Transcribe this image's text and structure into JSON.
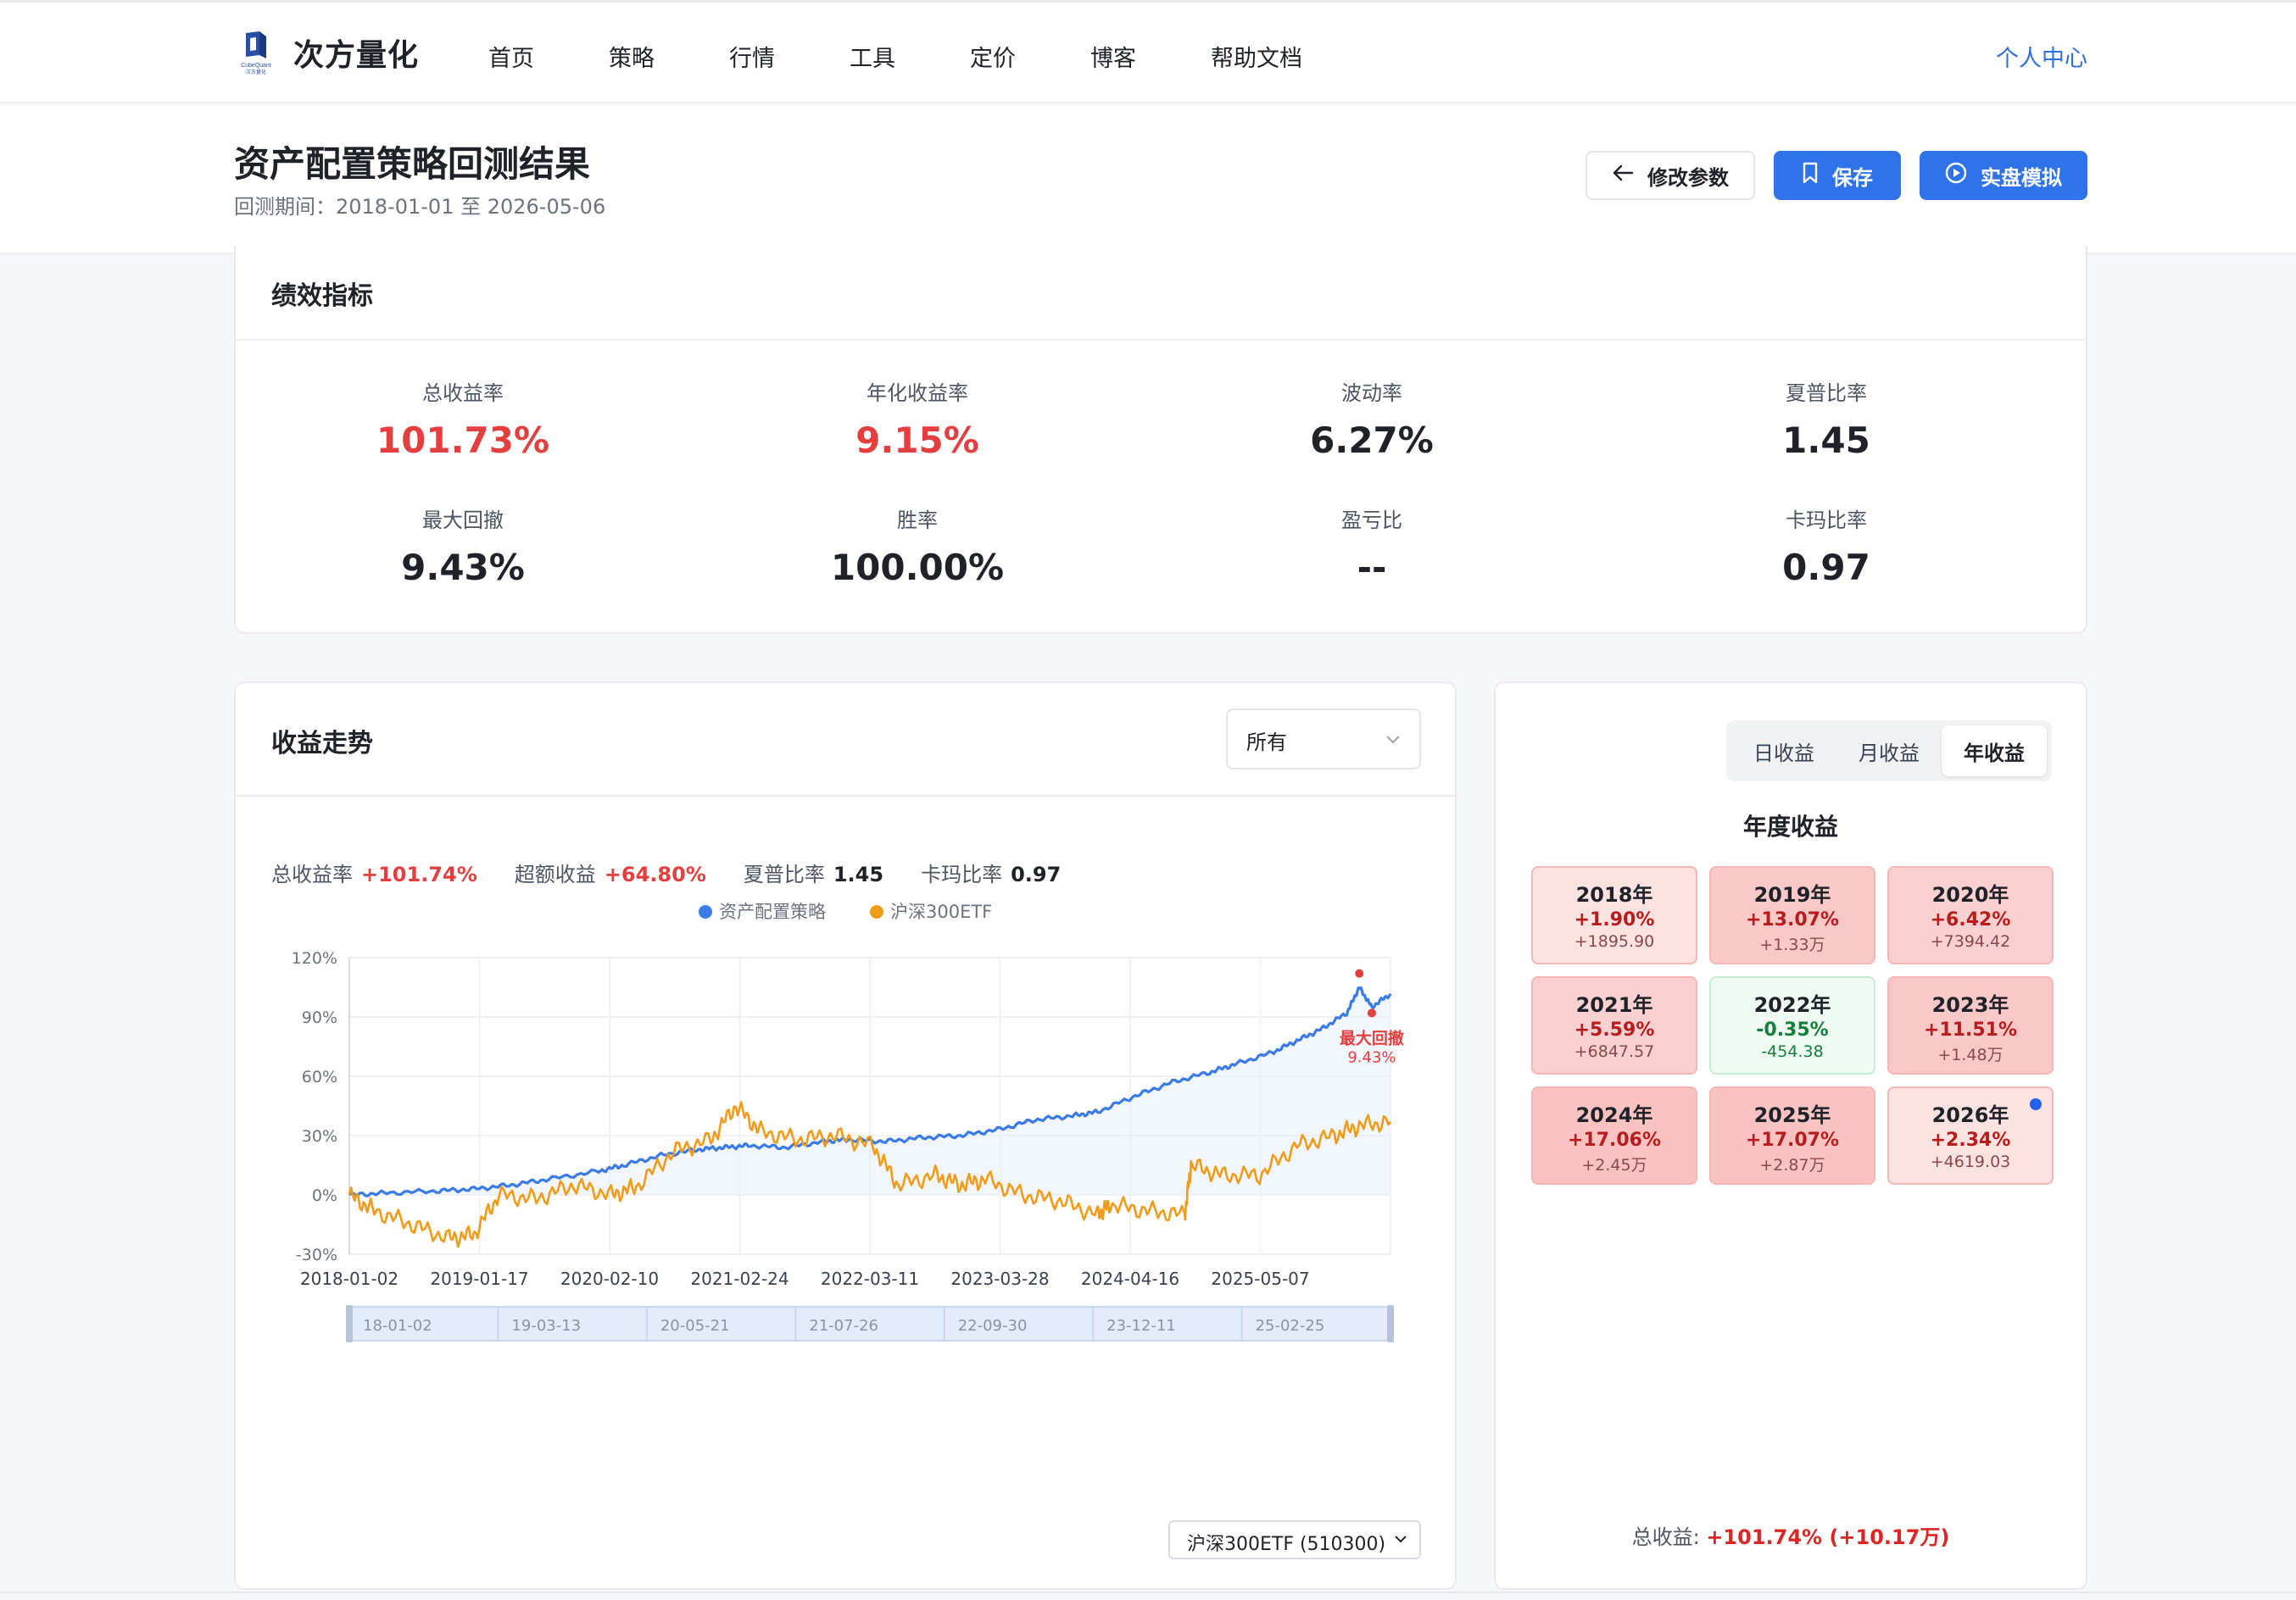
{
  "nav": {
    "brand": "次方量化",
    "logo_text": "CubeQuant 次方量化",
    "links": [
      "首页",
      "策略",
      "行情",
      "工具",
      "定价",
      "博客",
      "帮助文档"
    ],
    "user_center": "个人中心"
  },
  "header": {
    "title": "资产配置策略回测结果",
    "period": "回测期间：2018-01-01 至 2026-05-06",
    "btn_edit": "修改参数",
    "btn_save": "保存",
    "btn_sim": "实盘模拟"
  },
  "performance": {
    "title": "绩效指标",
    "metrics": [
      {
        "label": "总收益率",
        "value": "101.73%",
        "highlight": true
      },
      {
        "label": "年化收益率",
        "value": "9.15%",
        "highlight": true
      },
      {
        "label": "波动率",
        "value": "6.27%",
        "highlight": false
      },
      {
        "label": "夏普比率",
        "value": "1.45",
        "highlight": false
      },
      {
        "label": "最大回撤",
        "value": "9.43%",
        "highlight": false
      },
      {
        "label": "胜率",
        "value": "100.00%",
        "highlight": false
      },
      {
        "label": "盈亏比",
        "value": "--",
        "highlight": false
      },
      {
        "label": "卡玛比率",
        "value": "0.97",
        "highlight": false
      }
    ]
  },
  "trend": {
    "title": "收益走势",
    "range_select": "所有",
    "stats": [
      {
        "label": "总收益率",
        "value": "+101.74%",
        "color": "red"
      },
      {
        "label": "超额收益",
        "value": "+64.80%",
        "color": "red"
      },
      {
        "label": "夏普比率",
        "value": "1.45",
        "color": "dark"
      },
      {
        "label": "卡玛比率",
        "value": "0.97",
        "color": "dark"
      }
    ],
    "benchmark_select": "沪深300ETF (510300)"
  },
  "chart_data": {
    "type": "line",
    "legend": [
      "资产配置策略",
      "沪深300ETF"
    ],
    "legend_placement": "top-center",
    "y_ticks": [
      "120%",
      "90%",
      "60%",
      "30%",
      "0%",
      "-30%"
    ],
    "ylim": [
      -30,
      120
    ],
    "x_ticks": [
      "2018-01-02",
      "2019-01-17",
      "2020-02-10",
      "2021-02-24",
      "2022-03-11",
      "2023-03-28",
      "2024-04-16",
      "2025-05-07"
    ],
    "zoom_ticks": [
      "18-01-02",
      "19-03-13",
      "20-05-21",
      "21-07-26",
      "22-09-30",
      "23-12-11",
      "25-02-25"
    ],
    "grid": true,
    "annotation": {
      "label": "最大回撤",
      "value": "9.43%"
    },
    "series": [
      {
        "name": "资产配置策略",
        "color": "#3b7be8",
        "x": [
          2018.0,
          2018.3,
          2018.7,
          2019.0,
          2019.3,
          2019.6,
          2020.0,
          2020.2,
          2020.5,
          2020.8,
          2021.0,
          2021.2,
          2021.5,
          2021.8,
          2022.0,
          2022.3,
          2022.6,
          2022.9,
          2023.2,
          2023.5,
          2023.8,
          2024.0,
          2024.3,
          2024.6,
          2024.9,
          2025.1,
          2025.4,
          2025.6,
          2025.8,
          2026.0,
          2026.1,
          2026.2,
          2026.35
        ],
        "y": [
          0,
          1,
          2,
          3,
          5,
          8,
          12,
          15,
          20,
          23,
          24,
          25,
          24,
          27,
          28,
          27,
          29,
          30,
          33,
          38,
          40,
          42,
          50,
          57,
          62,
          66,
          72,
          78,
          84,
          92,
          105,
          95,
          101.7
        ]
      },
      {
        "name": "沪深300ETF",
        "color": "#f29b19",
        "x": [
          2018.0,
          2018.2,
          2018.5,
          2018.8,
          2019.0,
          2019.2,
          2019.5,
          2019.8,
          2020.1,
          2020.3,
          2020.6,
          2020.9,
          2021.1,
          2021.3,
          2021.6,
          2021.9,
          2022.2,
          2022.4,
          2022.7,
          2022.9,
          2023.1,
          2023.4,
          2023.7,
          2024.0,
          2024.1,
          2024.4,
          2024.7,
          2024.75,
          2025.0,
          2025.3,
          2025.6,
          2025.9,
          2026.1,
          2026.35
        ],
        "y": [
          0,
          -8,
          -15,
          -22,
          -20,
          0,
          -2,
          5,
          0,
          4,
          22,
          28,
          45,
          32,
          28,
          30,
          25,
          5,
          10,
          5,
          8,
          0,
          -3,
          -10,
          -5,
          -8,
          -10,
          15,
          10,
          10,
          25,
          30,
          35,
          37
        ]
      }
    ]
  },
  "annual": {
    "tabs": [
      "日收益",
      "月收益",
      "年收益"
    ],
    "active_tab": 2,
    "title": "年度收益",
    "years": [
      {
        "year": "2018年",
        "pct": "+1.90%",
        "amt": "+1895.90",
        "bg": "#fde2e2",
        "sign": "pos"
      },
      {
        "year": "2019年",
        "pct": "+13.07%",
        "amt": "+1.33万",
        "bg": "#fbc8c8",
        "sign": "pos"
      },
      {
        "year": "2020年",
        "pct": "+6.42%",
        "amt": "+7394.42",
        "bg": "#fbd0d0",
        "sign": "pos"
      },
      {
        "year": "2021年",
        "pct": "+5.59%",
        "amt": "+6847.57",
        "bg": "#fbd0d0",
        "sign": "pos"
      },
      {
        "year": "2022年",
        "pct": "-0.35%",
        "amt": "-454.38",
        "bg": "#eefaf2",
        "sign": "neg"
      },
      {
        "year": "2023年",
        "pct": "+11.51%",
        "amt": "+1.48万",
        "bg": "#fbc8c8",
        "sign": "pos"
      },
      {
        "year": "2024年",
        "pct": "+17.06%",
        "amt": "+2.45万",
        "bg": "#fbc2c2",
        "sign": "pos"
      },
      {
        "year": "2025年",
        "pct": "+17.07%",
        "amt": "+2.87万",
        "bg": "#fbc2c2",
        "sign": "pos"
      },
      {
        "year": "2026年",
        "pct": "+2.34%",
        "amt": "+4619.03",
        "bg": "#fde2e2",
        "sign": "pos",
        "current": true
      }
    ],
    "total_label": "总收益: ",
    "total_value": "+101.74% (+10.17万)"
  }
}
